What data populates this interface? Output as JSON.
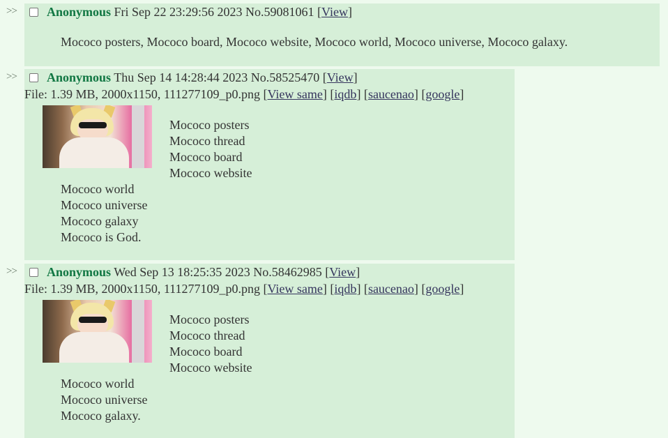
{
  "arrows": ">>",
  "posts": [
    {
      "name": "Anonymous",
      "date": "Fri Sep 22 23:29:56 2023",
      "no": "No.59081061",
      "view_open": "[",
      "view": "View",
      "view_close": "]",
      "message": [
        "Mococo posters, Mococo board, Mococo website, Mococo world, Mococo universe, Mococo galaxy."
      ]
    },
    {
      "name": "Anonymous",
      "date": "Thu Sep 14 14:28:44 2023",
      "no": "No.58525470",
      "view_open": "[",
      "view": "View",
      "view_close": "]",
      "file": {
        "prefix": "File: 1.39 MB, 2000x1150, 111277109_p0.png",
        "links": [
          "View same",
          "iqdb",
          "saucenao",
          "google"
        ]
      },
      "message": [
        "Mococo posters",
        "Mococo thread",
        "Mococo board",
        "Mococo website",
        "Mococo world",
        "Mococo universe",
        "Mococo galaxy",
        "Mococo is God."
      ]
    },
    {
      "name": "Anonymous",
      "date": "Wed Sep 13 18:25:35 2023",
      "no": "No.58462985",
      "view_open": "[",
      "view": "View",
      "view_close": "]",
      "file": {
        "prefix": "File: 1.39 MB, 2000x1150, 111277109_p0.png",
        "links": [
          "View same",
          "iqdb",
          "saucenao",
          "google"
        ]
      },
      "message": [
        "Mococo posters",
        "Mococo thread",
        "Mococo board",
        "Mococo website",
        "Mococo world",
        "Mococo universe",
        "Mococo galaxy."
      ]
    }
  ],
  "colors": {
    "background": "#eefaee",
    "reply_background": "#d6efd8",
    "name": "#117743",
    "link": "#34345c"
  },
  "icons": [
    "thumbnail-image",
    "checkbox"
  ]
}
